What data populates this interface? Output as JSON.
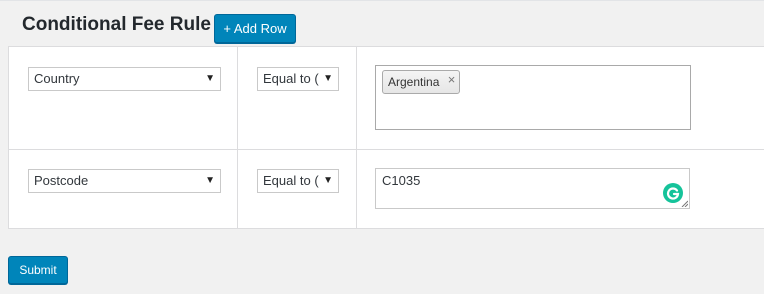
{
  "header": {
    "title": "Conditional Fee Rule",
    "add_row_label": "+ Add Row"
  },
  "rows": [
    {
      "field": "Country",
      "condition": "Equal to (",
      "tags": [
        "Argentina"
      ]
    },
    {
      "field": "Postcode",
      "condition": "Equal to (",
      "value": "C1035"
    }
  ],
  "submit_label": "Submit",
  "icons": {
    "dropdown": "chevron-down-icon",
    "remove_tag": "close-icon",
    "grammarly": "grammarly-icon",
    "resize": "resize-handle-icon"
  },
  "colors": {
    "primary_button": "#0085ba",
    "grammarly": "#15c39a"
  }
}
